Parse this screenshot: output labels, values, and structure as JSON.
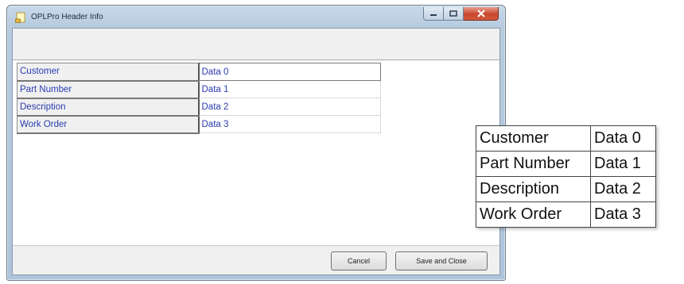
{
  "window": {
    "title": "OPLPro Header Info"
  },
  "header_fields": [
    {
      "label": "Customer",
      "value": "Data 0"
    },
    {
      "label": "Part Number",
      "value": "Data 1"
    },
    {
      "label": "Description",
      "value": "Data 2"
    },
    {
      "label": "Work Order",
      "value": "Data 3"
    }
  ],
  "buttons": {
    "cancel": "Cancel",
    "save_close": "Save and Close"
  },
  "zoomed_table": [
    {
      "label": "Customer",
      "value": "Data 0"
    },
    {
      "label": "Part Number",
      "value": "Data 1"
    },
    {
      "label": "Description",
      "value": "Data 2"
    },
    {
      "label": "Work Order",
      "value": "Data 3"
    }
  ],
  "icons": {
    "app": "document-icon",
    "minimize": "minimize-icon",
    "maximize": "maximize-icon",
    "close": "close-icon"
  }
}
